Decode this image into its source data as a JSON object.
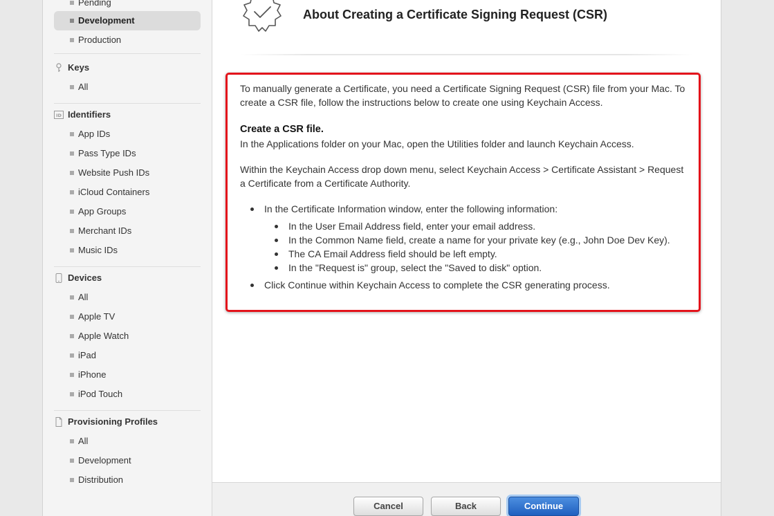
{
  "sidebar": {
    "certificates_items": [
      {
        "label": "Pending",
        "selected": false
      },
      {
        "label": "Development",
        "selected": true
      },
      {
        "label": "Production",
        "selected": false
      }
    ],
    "keys": {
      "title": "Keys",
      "items": [
        "All"
      ]
    },
    "identifiers": {
      "title": "Identifiers",
      "icon_text": "ID",
      "items": [
        "App IDs",
        "Pass Type IDs",
        "Website Push IDs",
        "iCloud Containers",
        "App Groups",
        "Merchant IDs",
        "Music IDs"
      ]
    },
    "devices": {
      "title": "Devices",
      "items": [
        "All",
        "Apple TV",
        "Apple Watch",
        "iPad",
        "iPhone",
        "iPod Touch"
      ]
    },
    "profiles": {
      "title": "Provisioning Profiles",
      "items": [
        "All",
        "Development",
        "Distribution"
      ]
    }
  },
  "main": {
    "title": "About Creating a Certificate Signing Request (CSR)",
    "intro": "To manually generate a Certificate, you need a Certificate Signing Request (CSR) file from your Mac. To create a CSR file, follow the instructions below to create one using Keychain Access.",
    "create_heading": "Create a CSR file.",
    "create_text": "In the Applications folder on your Mac, open the Utilities folder and launch Keychain Access.",
    "menu_text": "Within the Keychain Access drop down menu, select Keychain Access > Certificate Assistant > Request a Certificate from a Certificate Authority.",
    "bullet1": "In the Certificate Information window, enter the following information:",
    "sub_bullets": [
      "In the User Email Address field, enter your email address.",
      "In the Common Name field, create a name for your private key (e.g., John Doe Dev Key).",
      "The CA Email Address field should be left empty.",
      "In the \"Request is\" group, select the \"Saved to disk\" option."
    ],
    "bullet2": "Click Continue within Keychain Access to complete the CSR generating process."
  },
  "footer": {
    "cancel_label": "Cancel",
    "back_label": "Back",
    "continue_label": "Continue"
  },
  "colors": {
    "highlight_border": "#e3131b",
    "primary_button": "#1f5fbf"
  }
}
